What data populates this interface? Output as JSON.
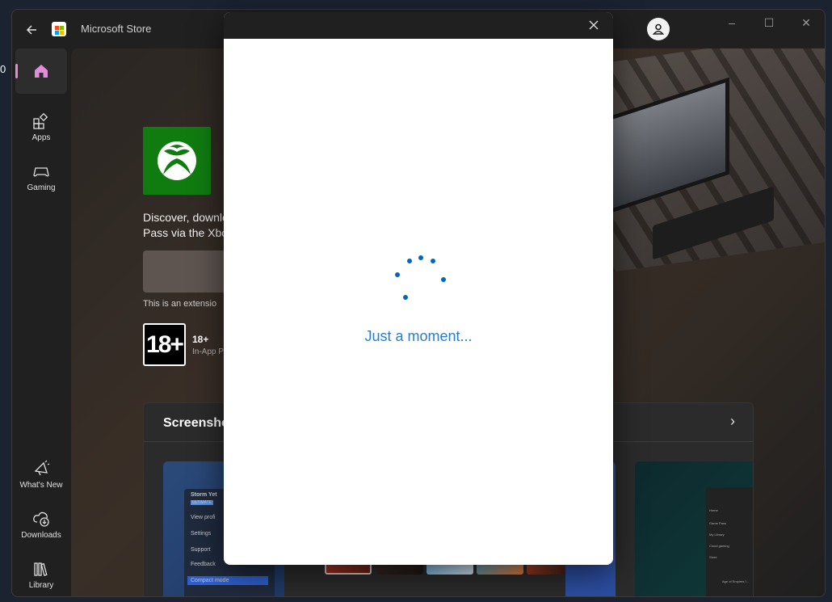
{
  "window": {
    "app_name": "Microsoft Store"
  },
  "desktop": {
    "edge_text": "0"
  },
  "sidebar": {
    "items": [
      {
        "label": "",
        "icon": "home-icon",
        "active": true
      },
      {
        "label": "Apps",
        "icon": "apps-icon"
      },
      {
        "label": "Gaming",
        "icon": "gamepad-icon"
      },
      {
        "label": "What's New",
        "icon": "megaphone-icon"
      },
      {
        "label": "Downloads",
        "icon": "cloud-download-icon"
      },
      {
        "label": "Library",
        "icon": "library-icon"
      }
    ]
  },
  "product": {
    "description_line1": "Discover, downlo",
    "description_line2": "Pass via the Xbo",
    "extension_note": "This is an extensio",
    "age_rating": "18+",
    "age_rating_label": "18+",
    "age_rating_sub": "In-App P",
    "brand_color": "#107c10"
  },
  "screenshots": {
    "title": "Screensho",
    "shot1_menu": {
      "user": "Storm Yet",
      "badge": "ULTIMATE",
      "items": [
        "View profi",
        "Settings",
        "Support",
        "Feedback"
      ],
      "toggle": "Compact mode"
    },
    "shot3_menu": {
      "items": [
        "Home",
        "Game Pass",
        "My Library",
        "Cloud gaming",
        "Store"
      ],
      "game": "Age of Empires I..."
    }
  },
  "dialog": {
    "loading_text": "Just a moment...",
    "accent_color": "#0067c0"
  }
}
